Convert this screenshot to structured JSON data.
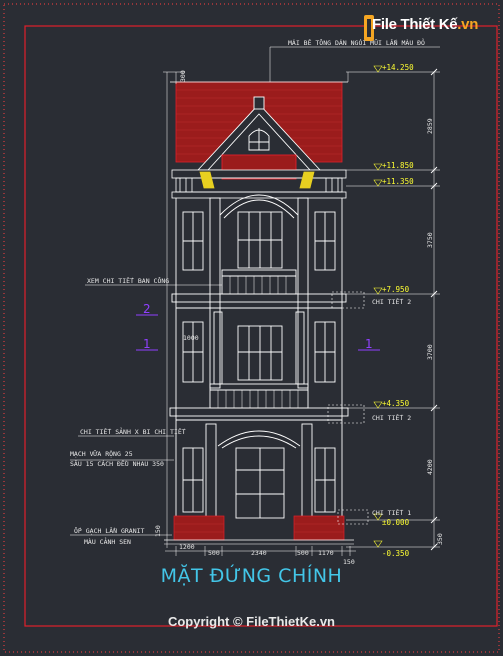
{
  "brand": {
    "name": "File Thiết Kế",
    "tld": ".vn"
  },
  "drawing_title": "MẶT ĐỨNG CHÍNH",
  "copyright": "Copyright © FileThietKe.vn",
  "colors": {
    "background": "#2a2d34",
    "frame": "#e0202a",
    "roof": "#9b1c1c",
    "lines": "#ffffff",
    "dimension": "#ffffff",
    "annotation": "#e8e8e8",
    "level_marker": "#ffff33",
    "grid_marker": "#9040ff",
    "title": "#43c6e8"
  },
  "annotations": {
    "roof_note": "MÁI BÊ TÔNG DÁN NGÓI MŨI LẤN MÀU ĐỎ",
    "balcony_note": "XEM CHI TIẾT BAN CÔNG",
    "detail_ground": "CHI TIẾT SẢNH X BI CHI TIẾT",
    "joint_note_1": "MẠCH VỮA RỘNG 25",
    "joint_note_2": "SÂU 15 CÁCH ĐỀU NHAU 350",
    "tile_note_1": "ỐP GẠCH LẦN GRANIT",
    "tile_note_2": "MÀU CẢNH SEN",
    "detail_2a": "CHI TIẾT 2",
    "detail_2b": "CHI TIẾT 2",
    "detail_1": "CHI TIẾT 1"
  },
  "levels": [
    "+14.250",
    "+11.850",
    "+11.350",
    "+7.950",
    "+4.350",
    "±0.000",
    "-0.350"
  ],
  "vertical_dims": [
    "2859",
    "3750",
    "3700",
    "4200",
    "350"
  ],
  "horizontal_dims": [
    "1200",
    "500",
    "2340",
    "500",
    "1170",
    "150"
  ],
  "roof_dim": "300",
  "small_dims": [
    "1000",
    "150"
  ],
  "grid_markers": {
    "left_2": "2",
    "left_1": "1",
    "right_1": "1"
  }
}
